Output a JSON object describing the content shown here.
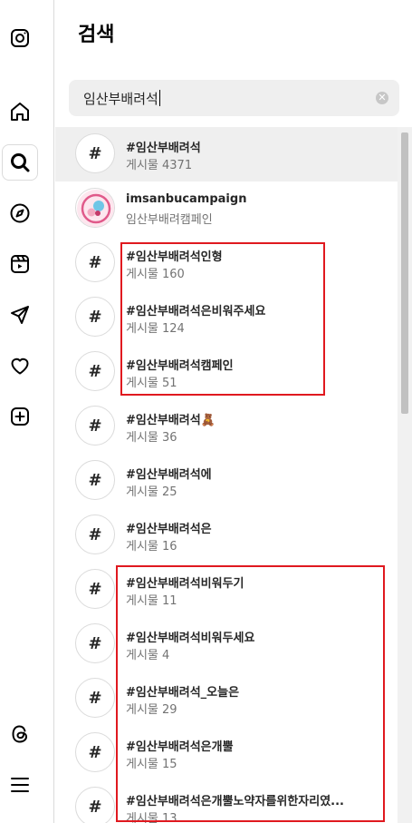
{
  "panel": {
    "title": "검색"
  },
  "search": {
    "value": "임산부배려석",
    "clear_icon": "x-circle-icon"
  },
  "nav": {
    "items": [
      {
        "name": "instagram-logo-icon"
      },
      {
        "name": "home-icon"
      },
      {
        "name": "search-icon"
      },
      {
        "name": "explore-compass-icon"
      },
      {
        "name": "reels-icon"
      },
      {
        "name": "messages-send-icon"
      },
      {
        "name": "notifications-heart-icon"
      },
      {
        "name": "create-plus-icon"
      },
      {
        "name": "threads-icon"
      },
      {
        "name": "more-menu-icon"
      }
    ]
  },
  "results": [
    {
      "title": "#임산부배려석",
      "sub": "게시물 4371"
    },
    {
      "title": "imsanbucampaign",
      "sub": "임산부배려캠페인"
    },
    {
      "title": "#임산부배려석인형",
      "sub": "게시물 160"
    },
    {
      "title": "#임산부배려석은비워주세요",
      "sub": "게시물 124"
    },
    {
      "title": "#임산부배려석캠페인",
      "sub": "게시물 51"
    },
    {
      "title": "#임산부배려석🧸",
      "sub": "게시물 36"
    },
    {
      "title": "#임산부배려석에",
      "sub": "게시물 25"
    },
    {
      "title": "#임산부배려석은",
      "sub": "게시물 16"
    },
    {
      "title": "#임산부배려석비워두기",
      "sub": "게시물 11"
    },
    {
      "title": "#임산부배려석비워두세요",
      "sub": "게시물 4"
    },
    {
      "title": "#임산부배려석_오늘은",
      "sub": "게시물 29"
    },
    {
      "title": "#임산부배려석은개뿔",
      "sub": "게시물 15"
    },
    {
      "title": "#임산부배려석은개뿔노약자를위한자리였...",
      "sub": "게시물 13"
    }
  ],
  "hash_symbol": "#"
}
